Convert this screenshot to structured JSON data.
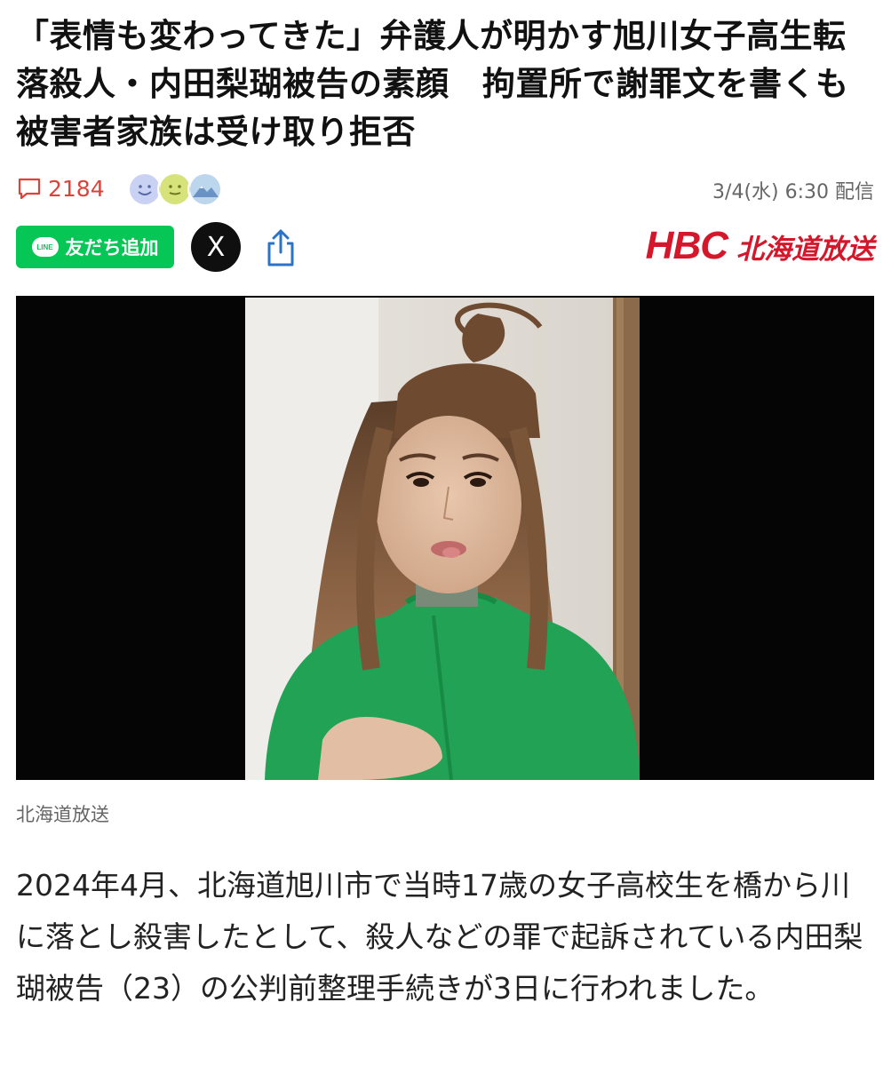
{
  "article": {
    "headline": "「表情も変わってきた」弁護人が明かす旭川女子高生転落殺人・内田梨瑚被告の素顔　拘置所で謝罪文を書くも被害者家族は受け取り拒否",
    "comment_count": "2184",
    "published": "3/4(水) 6:30 配信",
    "reactions": [
      "smile-face-icon",
      "neutral-face-icon",
      "mountain-icon"
    ],
    "share": {
      "line_label": "友だち追加",
      "line_logo": "LINE",
      "x_label": "X"
    },
    "publisher": {
      "logo_text": "HBC",
      "logo_name": "北海道放送"
    },
    "image": {
      "alt": "",
      "caption": "北海道放送"
    },
    "body": "2024年4月、北海道旭川市で当時17歳の女子高校生を橋から川に落とし殺害したとして、殺人などの罪で起訴されている内田梨瑚被告（23）の公判前整理手続きが3日に行われました。"
  },
  "colors": {
    "comment": "#e0423a",
    "line_green": "#06c755",
    "brand_red": "#d5172c",
    "photo_bg": "#050505",
    "jacket_green": "#21a254"
  }
}
